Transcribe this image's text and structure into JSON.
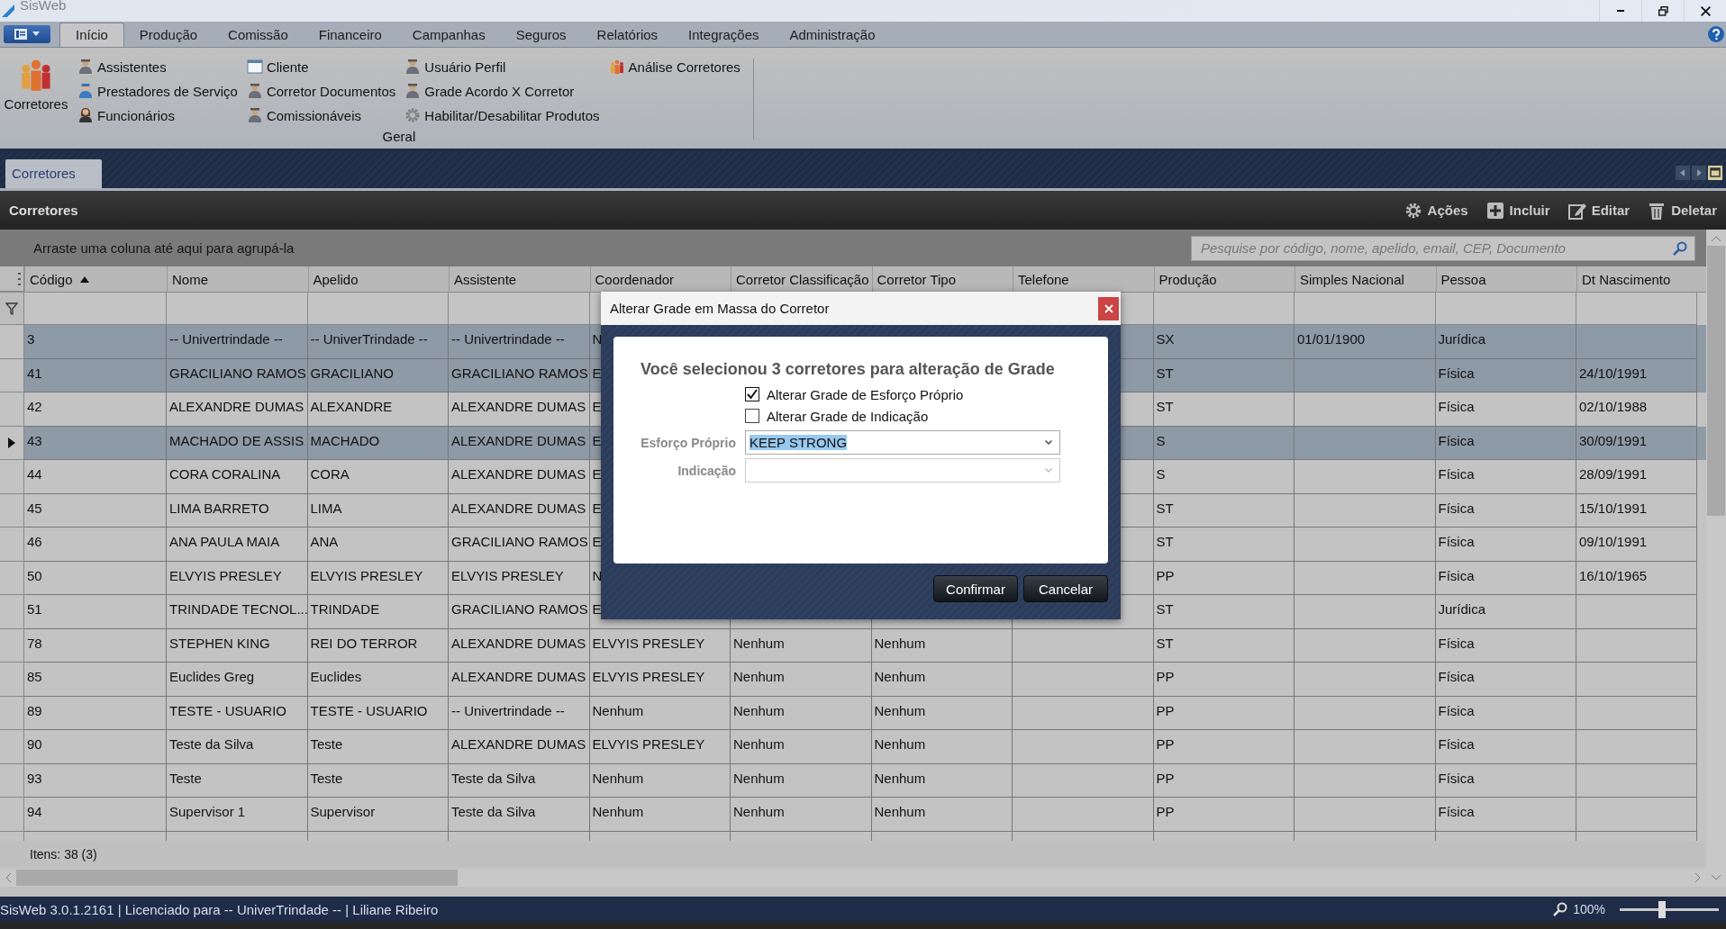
{
  "window": {
    "title": "SisWeb"
  },
  "ribbon_tabs": [
    {
      "label": "Início",
      "selected": true
    },
    {
      "label": "Produção",
      "selected": false
    },
    {
      "label": "Comissão",
      "selected": false
    },
    {
      "label": "Financeiro",
      "selected": false
    },
    {
      "label": "Campanhas",
      "selected": false
    },
    {
      "label": "Seguros",
      "selected": false
    },
    {
      "label": "Relatórios",
      "selected": false
    },
    {
      "label": "Integrações",
      "selected": false
    },
    {
      "label": "Administração",
      "selected": false
    }
  ],
  "ribbon": {
    "group_label": "Geral",
    "large_item": {
      "label": "Corretores",
      "kind": "group"
    },
    "columns": [
      [
        {
          "label": "Assistentes",
          "kind": "person"
        },
        {
          "label": "Prestadores de Serviço",
          "kind": "worker"
        },
        {
          "label": "Funcionários",
          "kind": "woman"
        }
      ],
      [
        {
          "label": "Cliente",
          "kind": "window"
        },
        {
          "label": "Corretor Documentos",
          "kind": "person"
        },
        {
          "label": "Comissionáveis",
          "kind": "person"
        }
      ],
      [
        {
          "label": "Usuário Perfil",
          "kind": "person"
        },
        {
          "label": "Grade Acordo X Corretor",
          "kind": "person"
        },
        {
          "label": "Habilitar/Desabilitar Produtos",
          "kind": "gear"
        }
      ],
      [
        {
          "label": "Análise Corretores",
          "kind": "group"
        }
      ]
    ]
  },
  "document_tabs": [
    {
      "label": "Corretores",
      "selected": true
    }
  ],
  "panel": {
    "title": "Corretores",
    "actions": [
      {
        "label": "Ações",
        "kind": "gear"
      },
      {
        "label": "Incluir",
        "kind": "plus"
      },
      {
        "label": "Editar",
        "kind": "edit"
      },
      {
        "label": "Deletar",
        "kind": "trash"
      }
    ]
  },
  "grid": {
    "group_hint": "Arraste uma coluna até aqui para agrupá-la",
    "search": {
      "placeholder": "Pesquise por código, nome, apelido, email, CEP, Documento"
    },
    "columns": [
      {
        "label": "Código",
        "sorted": true
      },
      {
        "label": "Nome"
      },
      {
        "label": "Apelido"
      },
      {
        "label": "Assistente"
      },
      {
        "label": "Coordenador"
      },
      {
        "label": "Corretor Classificação"
      },
      {
        "label": "Corretor Tipo"
      },
      {
        "label": "Telefone"
      },
      {
        "label": "Produção"
      },
      {
        "label": "Simples Nacional"
      },
      {
        "label": "Pessoa"
      },
      {
        "label": "Dt Nascimento"
      }
    ],
    "rows": [
      {
        "selected": true,
        "current": false,
        "cells": [
          "3",
          "-- Univertrindade --",
          "-- UniverTrindade --",
          "-- Univertrindade --",
          "N",
          "",
          "",
          "",
          "SX",
          "01/01/1900",
          "Jurídica",
          ""
        ]
      },
      {
        "selected": true,
        "current": false,
        "cells": [
          "41",
          "GRACILIANO RAMOS",
          "GRACILIANO",
          "GRACILIANO RAMOS",
          "E",
          "",
          "",
          "",
          "ST",
          "",
          "Física",
          "24/10/1991"
        ]
      },
      {
        "selected": false,
        "current": false,
        "cells": [
          "42",
          "ALEXANDRE DUMAS",
          "ALEXANDRE",
          "ALEXANDRE DUMAS",
          "E",
          "",
          "",
          "",
          "ST",
          "",
          "Física",
          "02/10/1988"
        ]
      },
      {
        "selected": true,
        "current": true,
        "cells": [
          "43",
          "MACHADO DE ASSIS",
          "MACHADO",
          "ALEXANDRE DUMAS",
          "E",
          "",
          "",
          "",
          "S",
          "",
          "Física",
          "30/09/1991"
        ]
      },
      {
        "selected": false,
        "current": false,
        "cells": [
          "44",
          "CORA CORALINA",
          "CORA",
          "ALEXANDRE DUMAS",
          "E",
          "",
          "",
          "",
          "S",
          "",
          "Física",
          "28/09/1991"
        ]
      },
      {
        "selected": false,
        "current": false,
        "cells": [
          "45",
          "LIMA BARRETO",
          "LIMA",
          "ALEXANDRE DUMAS",
          "E",
          "",
          "",
          "",
          "ST",
          "",
          "Física",
          "15/10/1991"
        ]
      },
      {
        "selected": false,
        "current": false,
        "cells": [
          "46",
          "ANA PAULA MAIA",
          "ANA",
          "GRACILIANO RAMOS",
          "E",
          "",
          "",
          "",
          "ST",
          "",
          "Física",
          "09/10/1991"
        ]
      },
      {
        "selected": false,
        "current": false,
        "cells": [
          "50",
          "ELVYIS PRESLEY",
          "ELVYIS PRESLEY",
          "ELVYIS PRESLEY",
          "N",
          "",
          "",
          "",
          "PP",
          "",
          "Física",
          "16/10/1965"
        ]
      },
      {
        "selected": false,
        "current": false,
        "cells": [
          "51",
          "TRINDADE TECNOL...",
          "TRINDADE",
          "GRACILIANO RAMOS",
          "E",
          "",
          "",
          "",
          "ST",
          "",
          "Jurídica",
          ""
        ]
      },
      {
        "selected": false,
        "current": false,
        "cells": [
          "78",
          "STEPHEN KING",
          "REI DO TERROR",
          "ALEXANDRE DUMAS",
          "ELVYIS PRESLEY",
          "Nenhum",
          "Nenhum",
          "",
          "ST",
          "",
          "Física",
          ""
        ]
      },
      {
        "selected": false,
        "current": false,
        "cells": [
          "85",
          "Euclides Greg",
          "Euclides",
          "ALEXANDRE DUMAS",
          "ELVYIS PRESLEY",
          "Nenhum",
          "Nenhum",
          "",
          "PP",
          "",
          "Física",
          ""
        ]
      },
      {
        "selected": false,
        "current": false,
        "cells": [
          "89",
          "TESTE - USUARIO",
          "TESTE - USUARIO",
          "-- Univertrindade --",
          "Nenhum",
          "Nenhum",
          "Nenhum",
          "",
          "PP",
          "",
          "Física",
          ""
        ]
      },
      {
        "selected": false,
        "current": false,
        "cells": [
          "90",
          "Teste da Silva",
          "Teste",
          "ALEXANDRE DUMAS",
          "ELVYIS PRESLEY",
          "Nenhum",
          "Nenhum",
          "",
          "PP",
          "",
          "Física",
          ""
        ]
      },
      {
        "selected": false,
        "current": false,
        "cells": [
          "93",
          "Teste",
          "Teste",
          "Teste da Silva",
          "Nenhum",
          "Nenhum",
          "Nenhum",
          "",
          "PP",
          "",
          "Física",
          ""
        ]
      },
      {
        "selected": false,
        "current": false,
        "cells": [
          "94",
          "Supervisor 1",
          "Supervisor",
          "Teste da Silva",
          "Nenhum",
          "Nenhum",
          "Nenhum",
          "",
          "PP",
          "",
          "Física",
          ""
        ]
      }
    ],
    "footer": "Itens: 38 (3)"
  },
  "dialog": {
    "title": "Alterar Grade em Massa do Corretor",
    "heading": "Você selecionou 3 corretores para alteração de Grade",
    "checkboxes": [
      {
        "label": "Alterar Grade de Esforço Próprio",
        "checked": true
      },
      {
        "label": "Alterar Grade de Indicação",
        "checked": false
      }
    ],
    "fields": [
      {
        "label": "Esforço Próprio",
        "value": "KEEP STRONG",
        "value_selected": true,
        "disabled": false
      },
      {
        "label": "Indicação",
        "disabled": true
      }
    ],
    "buttons": [
      "Confirmar",
      "Cancelar"
    ]
  },
  "status_bar": {
    "text": "SisWeb 3.0.1.2161 | Licenciado para -- UniverTrindade -- | Liliane Ribeiro",
    "zoom": "100%",
    "zoom_slider": {
      "level": 0.43
    }
  }
}
